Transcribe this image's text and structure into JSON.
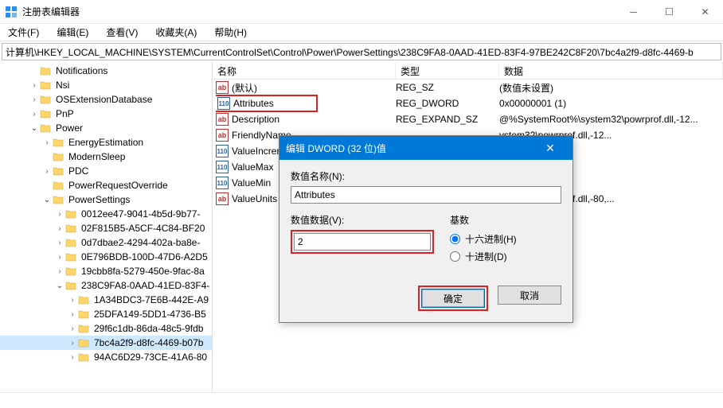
{
  "window": {
    "title": "注册表编辑器"
  },
  "menu": {
    "file": "文件(F)",
    "edit": "编辑(E)",
    "view": "查看(V)",
    "favorites": "收藏夹(A)",
    "help": "帮助(H)"
  },
  "address": "计算机\\HKEY_LOCAL_MACHINE\\SYSTEM\\CurrentControlSet\\Control\\Power\\PowerSettings\\238C9FA8-0AAD-41ED-83F4-97BE242C8F20\\7bc4a2f9-d8fc-4469-b",
  "tree": [
    {
      "indent": 2,
      "chev": "",
      "label": "Notifications"
    },
    {
      "indent": 2,
      "chev": ">",
      "label": "Nsi"
    },
    {
      "indent": 2,
      "chev": ">",
      "label": "OSExtensionDatabase"
    },
    {
      "indent": 2,
      "chev": ">",
      "label": "PnP"
    },
    {
      "indent": 2,
      "chev": "v",
      "label": "Power"
    },
    {
      "indent": 3,
      "chev": ">",
      "label": "EnergyEstimation"
    },
    {
      "indent": 3,
      "chev": "",
      "label": "ModernSleep"
    },
    {
      "indent": 3,
      "chev": ">",
      "label": "PDC"
    },
    {
      "indent": 3,
      "chev": "",
      "label": "PowerRequestOverride"
    },
    {
      "indent": 3,
      "chev": "v",
      "label": "PowerSettings"
    },
    {
      "indent": 4,
      "chev": ">",
      "label": "0012ee47-9041-4b5d-9b77-"
    },
    {
      "indent": 4,
      "chev": ">",
      "label": "02F815B5-A5CF-4C84-BF20"
    },
    {
      "indent": 4,
      "chev": ">",
      "label": "0d7dbae2-4294-402a-ba8e-"
    },
    {
      "indent": 4,
      "chev": ">",
      "label": "0E796BDB-100D-47D6-A2D5"
    },
    {
      "indent": 4,
      "chev": ">",
      "label": "19cbb8fa-5279-450e-9fac-8a"
    },
    {
      "indent": 4,
      "chev": "v",
      "label": "238C9FA8-0AAD-41ED-83F4-"
    },
    {
      "indent": 5,
      "chev": ">",
      "label": "1A34BDC3-7E6B-442E-A9"
    },
    {
      "indent": 5,
      "chev": ">",
      "label": "25DFA149-5DD1-4736-B5"
    },
    {
      "indent": 5,
      "chev": ">",
      "label": "29f6c1db-86da-48c5-9fdb"
    },
    {
      "indent": 5,
      "chev": ">",
      "label": "7bc4a2f9-d8fc-4469-b07b",
      "selected": true
    },
    {
      "indent": 5,
      "chev": ">",
      "label": "94AC6D29-73CE-41A6-80"
    }
  ],
  "list": {
    "headers": {
      "name": "名称",
      "type": "类型",
      "data": "数据"
    },
    "rows": [
      {
        "icon": "ab",
        "name": "(默认)",
        "type": "REG_SZ",
        "data": "(数值未设置)"
      },
      {
        "icon": "num",
        "name": "Attributes",
        "type": "REG_DWORD",
        "data": "0x00000001 (1)",
        "highlight": true
      },
      {
        "icon": "ab",
        "name": "Description",
        "type": "REG_EXPAND_SZ",
        "data": "@%SystemRoot%\\system32\\powrprof.dll,-12..."
      },
      {
        "icon": "ab",
        "name": "FriendlyName",
        "type": "",
        "data": "ystem32\\powrprof.dll,-12..."
      },
      {
        "icon": "num",
        "name": "ValueIncrement",
        "type": "",
        "data": ""
      },
      {
        "icon": "num",
        "name": "ValueMax",
        "type": "",
        "data": ""
      },
      {
        "icon": "num",
        "name": "ValueMin",
        "type": "",
        "data": ""
      },
      {
        "icon": "ab",
        "name": "ValueUnits",
        "type": "",
        "data": "ystem32\\powrprof.dll,-80,..."
      }
    ]
  },
  "dialog": {
    "title": "编辑 DWORD (32 位)值",
    "name_label": "数值名称(N):",
    "name_value": "Attributes",
    "data_label": "数值数据(V):",
    "data_value": "2",
    "base_label": "基数",
    "hex_label": "十六进制(H)",
    "dec_label": "十进制(D)",
    "ok": "确定",
    "cancel": "取消"
  }
}
